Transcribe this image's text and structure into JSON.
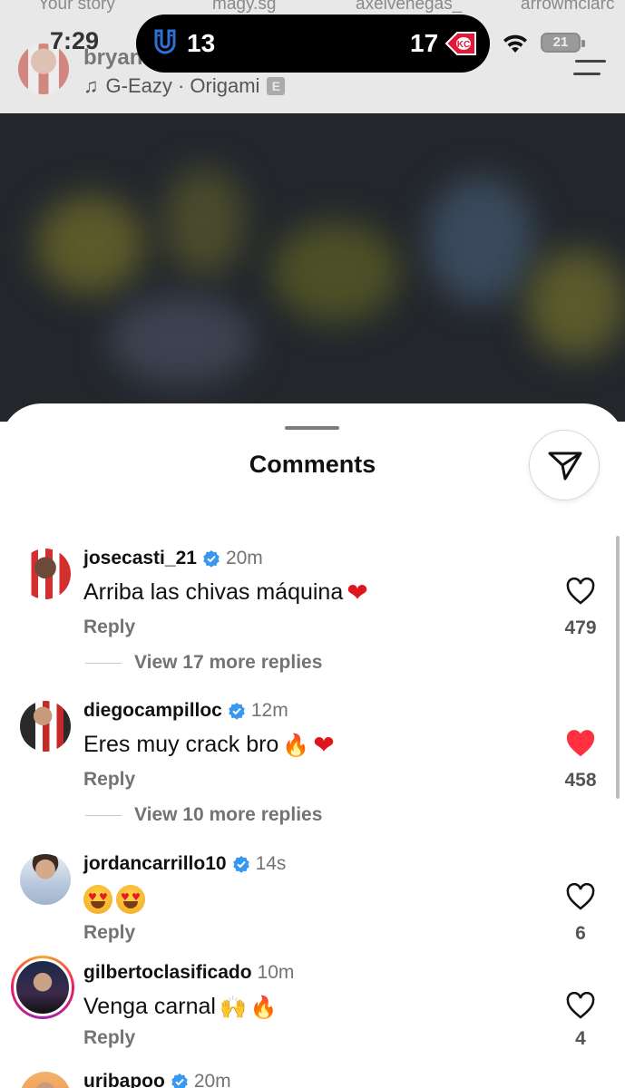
{
  "stories": [
    "Your story",
    "magy.sg",
    "axelvenegas_",
    "arrowmclarc"
  ],
  "status_bar": {
    "time": "7:29",
    "battery": "21"
  },
  "live_activity": {
    "left_score": "13",
    "right_score": "17",
    "left_team_icon": "colts-horseshoe-icon",
    "right_team_icon": "chiefs-arrowhead-icon"
  },
  "post": {
    "username": "bryan",
    "music": "G-Eazy · Origami",
    "explicit": "E"
  },
  "comments_sheet": {
    "title": "Comments",
    "comments": [
      {
        "username": "josecasti_21",
        "verified": true,
        "time": "20m",
        "text": "Arriba las chivas máquina",
        "emoji": [
          "red-heart"
        ],
        "reply_label": "Reply",
        "likes": "479",
        "liked": false,
        "view_replies": "View 17 more replies"
      },
      {
        "username": "diegocampilloc",
        "verified": true,
        "time": "12m",
        "text": "Eres muy crack bro",
        "emoji": [
          "fire",
          "red-heart"
        ],
        "reply_label": "Reply",
        "likes": "458",
        "liked": true,
        "view_replies": "View 10 more replies"
      },
      {
        "username": "jordancarrillo10",
        "verified": true,
        "time": "14s",
        "text": "",
        "emoji": [
          "heart-eyes",
          "heart-eyes"
        ],
        "reply_label": "Reply",
        "likes": "6",
        "liked": false
      },
      {
        "username": "gilbertoclasificado",
        "verified": false,
        "time": "10m",
        "text": "Venga carnal",
        "emoji": [
          "raising-hands",
          "fire"
        ],
        "reply_label": "Reply",
        "likes": "4",
        "liked": false,
        "has_story": true
      },
      {
        "username": "uribapoo",
        "verified": true,
        "time": "20m"
      }
    ]
  },
  "colors": {
    "verified_blue": "#3897f0",
    "like_red": "#ff3040",
    "muted_text": "#737373"
  }
}
